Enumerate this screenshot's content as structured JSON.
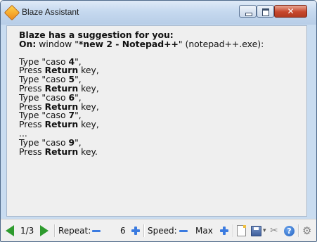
{
  "window": {
    "title": "Blaze Assistant",
    "close_glyph": "✕"
  },
  "suggestion": {
    "heading": "Blaze has a suggestion for you:",
    "on_label": "On:",
    "on_prefix": " window \"",
    "window_name": "*new 2 - Notepad++",
    "on_suffix": "\" (notepad++.exe):",
    "steps": [
      {
        "pre": "Type \"caso ",
        "bold": "4",
        "post": "\","
      },
      {
        "pre": "Press ",
        "bold": "Return",
        "post": " key,"
      },
      {
        "pre": "Type \"caso ",
        "bold": "5",
        "post": "\","
      },
      {
        "pre": "Press ",
        "bold": "Return",
        "post": " key,"
      },
      {
        "pre": "Type \"caso ",
        "bold": "6",
        "post": "\","
      },
      {
        "pre": "Press ",
        "bold": "Return",
        "post": " key,"
      },
      {
        "pre": "Type \"caso ",
        "bold": "7",
        "post": "\","
      },
      {
        "pre": "Press ",
        "bold": "Return",
        "post": " key,"
      },
      {
        "pre": "...",
        "bold": "",
        "post": ""
      },
      {
        "pre": "Type \"caso ",
        "bold": "9",
        "post": "\","
      },
      {
        "pre": "Press ",
        "bold": "Return",
        "post": " key."
      }
    ]
  },
  "toolbar": {
    "page_indicator": "1/3",
    "repeat_label": "Repeat:",
    "repeat_value": "6",
    "speed_label": "Speed:",
    "speed_value": "Max",
    "dropdown_caret": "▾",
    "tools_glyph": "✂",
    "help_glyph": "?",
    "gear_glyph": "⚙"
  },
  "colors": {
    "title_bar": "#c6d9ef",
    "content_bg": "#efefef",
    "nav_arrow": "#2e9b2e",
    "stepper": "#3b7be0",
    "close_button": "#c7472c"
  },
  "icons": [
    "app-diamond-icon",
    "minimize-icon",
    "maximize-icon",
    "close-icon",
    "previous-arrow-icon",
    "next-arrow-icon",
    "minus-icon",
    "plus-icon",
    "new-document-icon",
    "save-icon",
    "tools-icon",
    "help-icon",
    "gear-icon"
  ]
}
